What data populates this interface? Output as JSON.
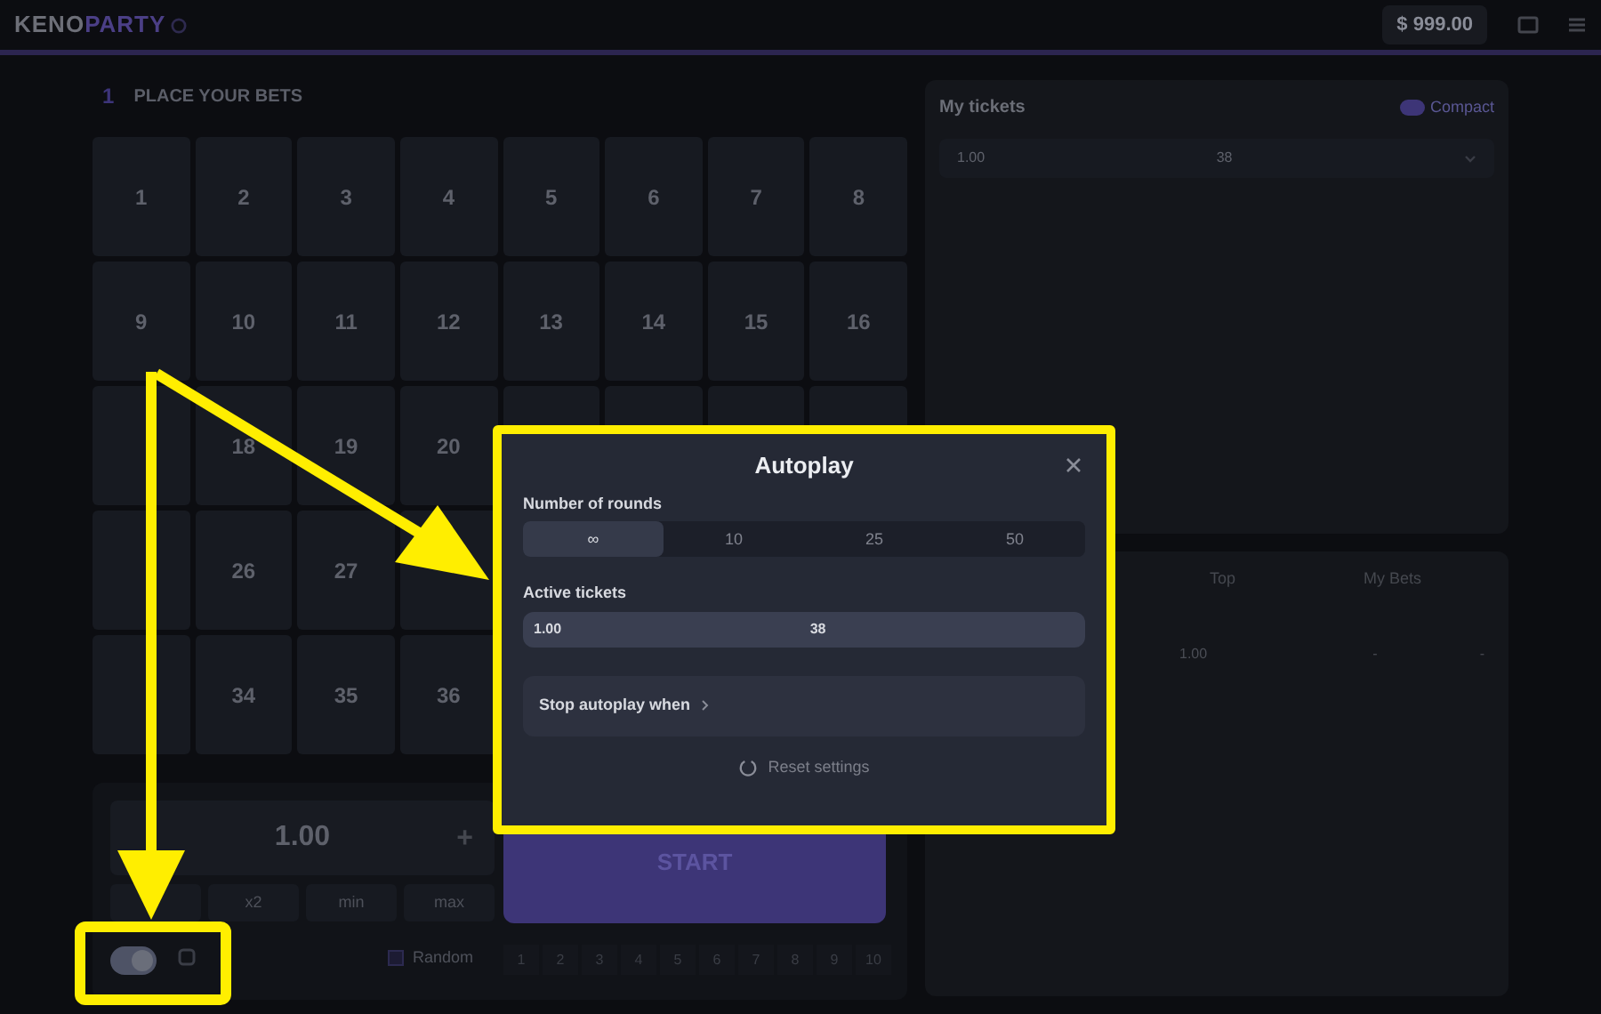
{
  "header": {
    "logo_primary": "KENO",
    "logo_accent": "PARTY",
    "balance": "$ 999.00"
  },
  "bets_panel": {
    "step": "1",
    "title": "PLACE YOUR BETS",
    "cells": [
      "1",
      "2",
      "3",
      "4",
      "5",
      "6",
      "7",
      "8",
      "9",
      "10",
      "11",
      "12",
      "13",
      "14",
      "15",
      "16",
      null,
      "18",
      "19",
      "20",
      null,
      null,
      null,
      null,
      null,
      "26",
      "27",
      null,
      null,
      null,
      null,
      null,
      null,
      "34",
      "35",
      "36",
      null,
      null,
      null,
      null
    ],
    "bet_amount": "1.00",
    "increase": "+",
    "quick_buttons": [
      "x2",
      "min",
      "max"
    ],
    "start": "START",
    "autoplay_toggle": {
      "on": true
    },
    "random": {
      "label": "Random",
      "checked": false
    },
    "picks": [
      "1",
      "2",
      "3",
      "4",
      "5",
      "6",
      "7",
      "8",
      "9",
      "10"
    ]
  },
  "tickets_panel": {
    "title": "My tickets",
    "compact": {
      "label": "Compact",
      "on": true
    },
    "rows": [
      {
        "amount": "1.00",
        "count": "38"
      }
    ]
  },
  "history_panel": {
    "tabs": [
      {
        "label": "Top",
        "selected": false
      },
      {
        "label": "My Bets",
        "selected": false
      }
    ],
    "rows": [
      {
        "column_1": "1.00",
        "column_2": "-",
        "column_3": "-"
      }
    ]
  },
  "autoplay_dialog": {
    "title": "Autoplay",
    "rounds_label": "Number of rounds",
    "rounds": [
      {
        "label": "∞",
        "selected": true
      },
      {
        "label": "10",
        "selected": false
      },
      {
        "label": "25",
        "selected": false
      },
      {
        "label": "50",
        "selected": false
      }
    ],
    "tickets_label": "Active tickets",
    "tickets": [
      {
        "amount": "1.00",
        "count": "38"
      }
    ],
    "stop_label": "Stop autoplay when",
    "reset": "Reset settings"
  }
}
